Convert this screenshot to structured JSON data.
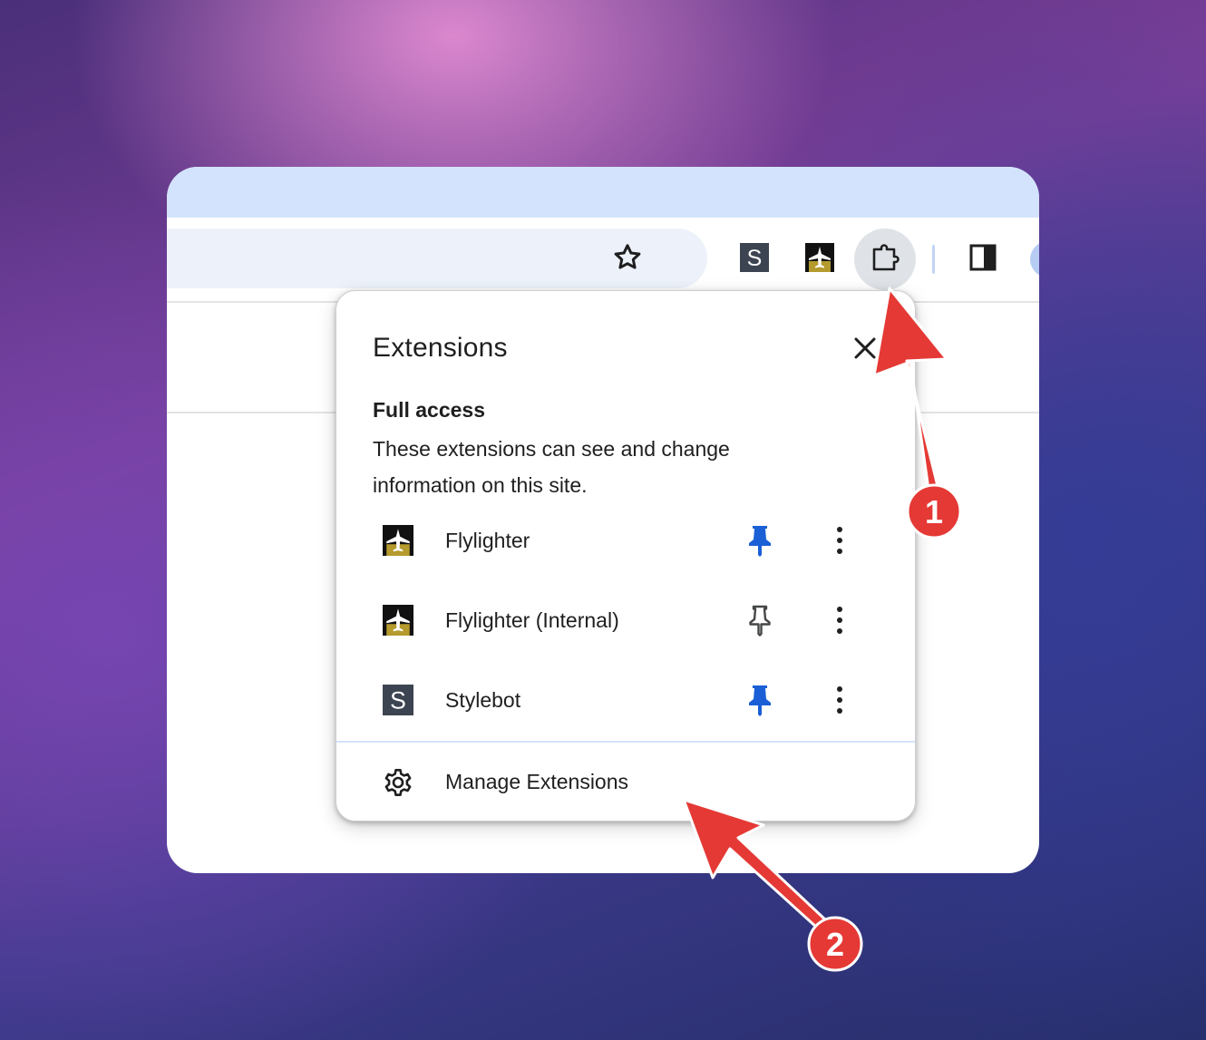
{
  "popup": {
    "title": "Extensions",
    "close_icon": "close-icon",
    "section_title": "Full access",
    "section_description": "These extensions can see and change information on this site.",
    "extensions": [
      {
        "name": "Flylighter",
        "icon": "flylighter-icon",
        "pinned": true
      },
      {
        "name": "Flylighter (Internal)",
        "icon": "flylighter-icon",
        "pinned": false
      },
      {
        "name": "Stylebot",
        "icon": "stylebot-icon",
        "pinned": true
      }
    ],
    "manage_label": "Manage Extensions"
  },
  "toolbar": {
    "pinned_extensions": [
      "stylebot-icon",
      "flylighter-icon"
    ],
    "extensions_button_icon": "puzzle-icon",
    "side_panel_icon": "side-panel-icon",
    "bookmark_icon": "star-icon"
  },
  "stylebot_glyph": "S",
  "annotations": [
    {
      "label": "1",
      "target": "extensions-button"
    },
    {
      "label": "2",
      "target": "manage-extensions"
    }
  ],
  "colors": {
    "tabstrip": "#d3e3fd",
    "omnibox": "#edf2fa",
    "pin_active": "#1a5fd6",
    "pin_inactive": "#444746",
    "annotation_red": "#e53935",
    "stylebot_bg": "#3c4451",
    "flylighter_bg": "#111111",
    "flylighter_gold": "#b59a2e"
  }
}
